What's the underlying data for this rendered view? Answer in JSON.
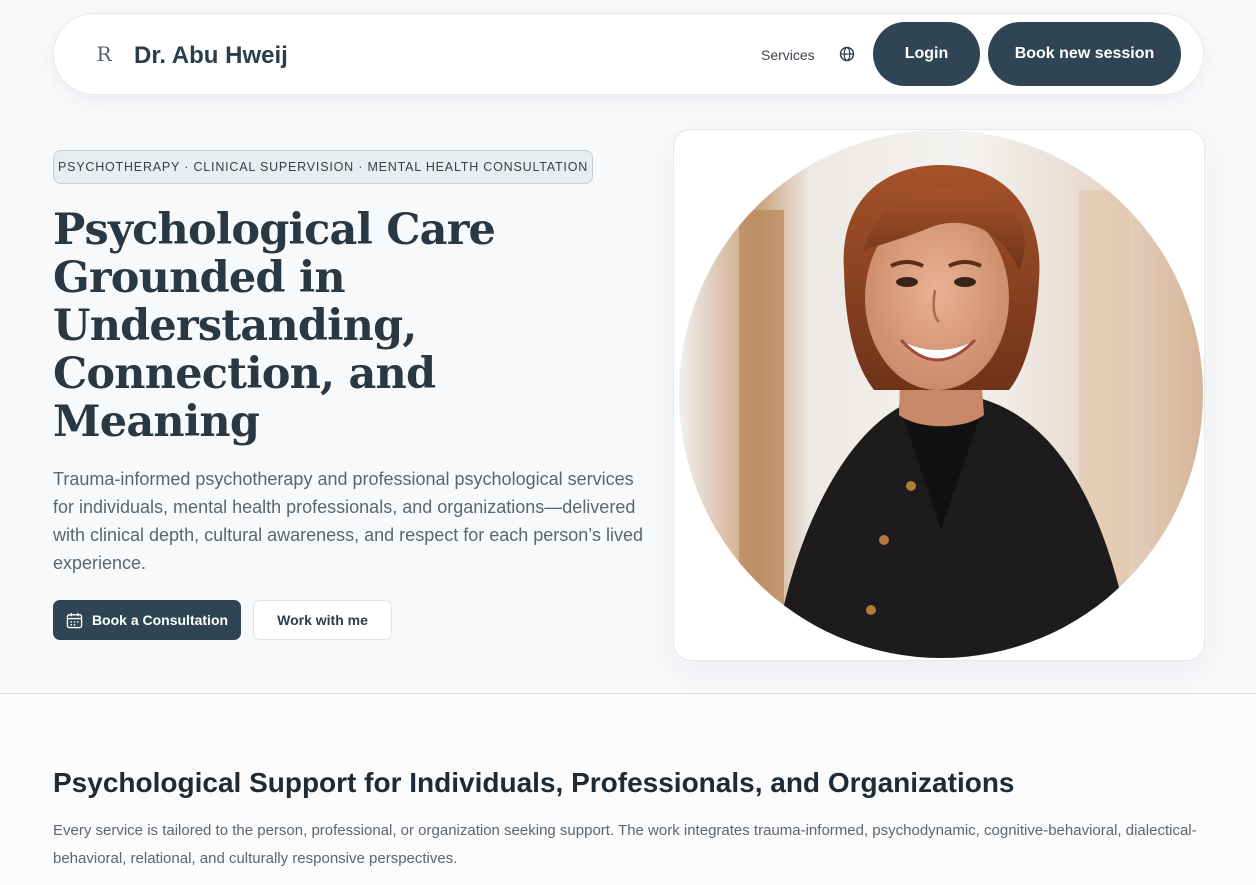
{
  "header": {
    "logo_icon": "R-monogram-icon",
    "logo_text": "R",
    "brand": "Dr. Abu Hweij",
    "nav_services": "Services",
    "language_icon": "globe-icon",
    "login_label": "Login",
    "book_session_label": "Book new session"
  },
  "hero": {
    "badge": "PSYCHOTHERAPY · CLINICAL SUPERVISION · MENTAL HEALTH CONSULTATION",
    "title_lines": [
      "Psychological Care",
      "Grounded in",
      "Understanding,",
      "Connection, and",
      "Meaning"
    ],
    "description": "Trauma-informed psychotherapy and professional psychological services for individuals, mental health professionals, and organizations—delivered with clinical depth, cultural awareness, and respect for each person’s lived experience.",
    "consult_label": "Book a Consultation",
    "consult_icon": "calendar-icon",
    "work_label": "Work with me",
    "photo": "portrait-photo"
  },
  "section": {
    "title": "Psychological Support for Individuals, Professionals, and Organizations",
    "description": "Every service is tailored to the person, professional, or organization seeking support. The work integrates trauma-informed, psychodynamic, cognitive-behavioral, dialectical-behavioral, relational, and culturally responsive perspectives."
  },
  "colors": {
    "primary": "#2f4553",
    "background": "#f8f9fb",
    "text": "#2c3e4c"
  }
}
